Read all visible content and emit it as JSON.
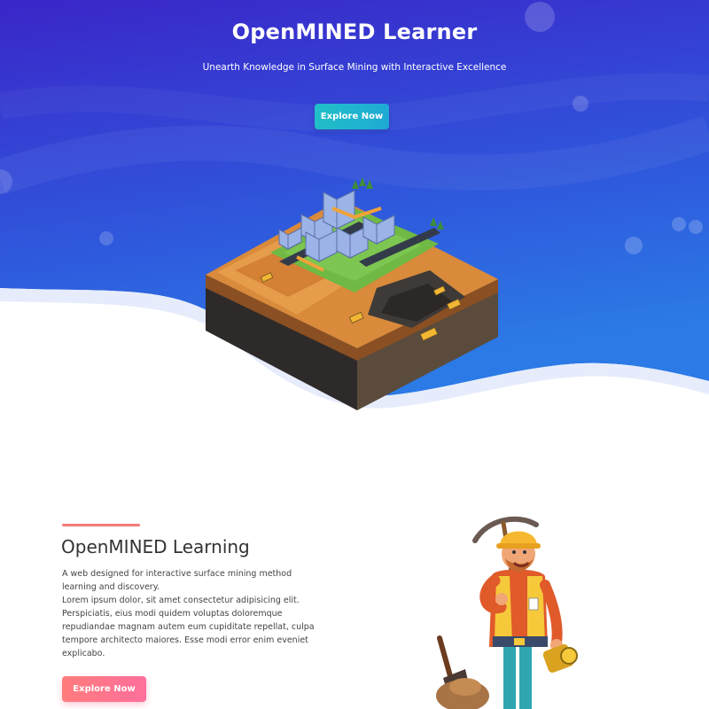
{
  "hero": {
    "title": "OpenMINED Learner",
    "subtitle": "Unearth Knowledge in Surface Mining with Interactive Excellence",
    "button_label": "Explore Now",
    "colors": {
      "gradient_top": "#3d2bcd",
      "gradient_bottom": "#2a7be4",
      "button": "#21c0c8"
    }
  },
  "about": {
    "title": "OpenMINED Learning",
    "paragraphs": [
      "A web designed for interactive surface mining method learning and discovery.",
      "Lorem ipsum dolor, sit amet consectetur adipisicing elit. Perspiciatis, eius modi quidem voluptas doloremque repudiandae magnam autem eum cupiditate repellat, culpa tempore architecto maiores. Esse modi error enim eveniet explicabo."
    ],
    "button_label": "Explore Now",
    "colors": {
      "accent_line": "#f47a78",
      "button": "#ff7487"
    }
  },
  "icons": {
    "hero_illustration": "isometric-surface-mine-illustration",
    "miner_illustration": "miner-with-pickaxe-illustration"
  }
}
